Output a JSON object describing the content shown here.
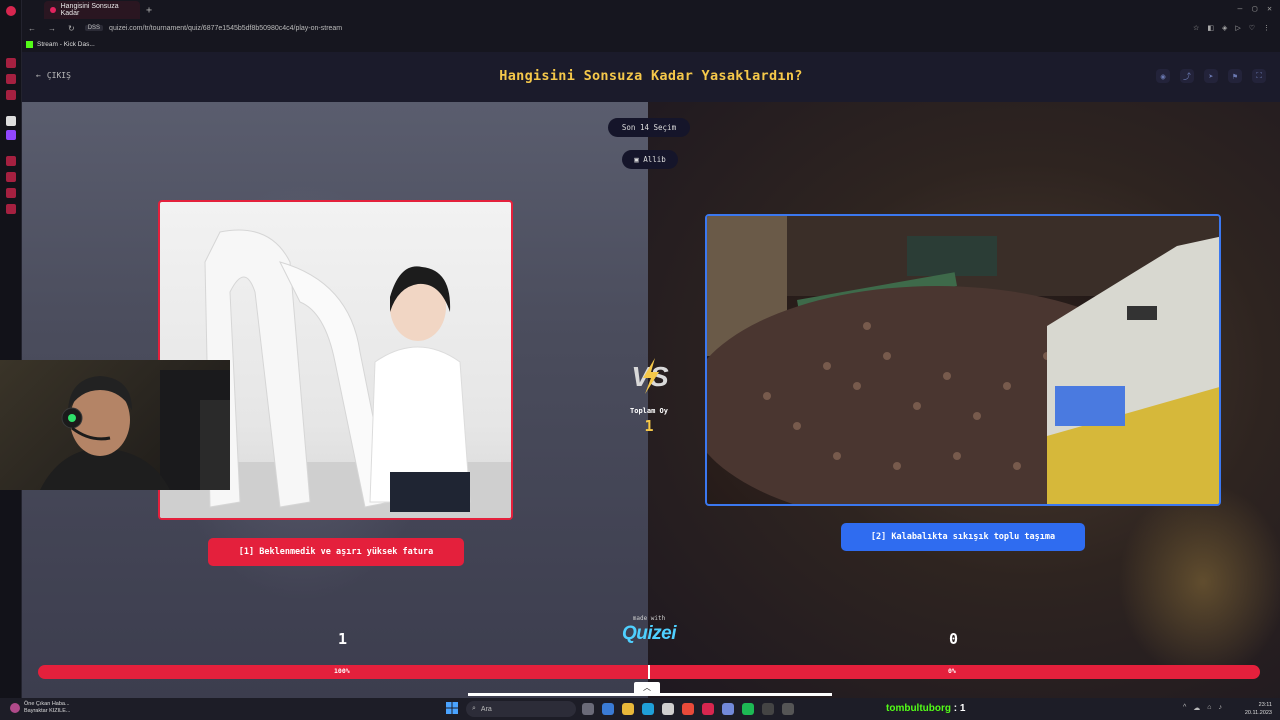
{
  "browser": {
    "tab_title": "Hangisini Sonsuza Kadar",
    "tab_plus": "+",
    "window_controls": [
      "—",
      "▢",
      "✕"
    ],
    "url_prefix": "DSS",
    "url": "quizei.com/tr/tournament/quiz/6877e1545b5df8b50980c4c4/play-on-stream",
    "bookmark": "Stream - Kick Das..."
  },
  "header": {
    "exit_label": "ÇIKIŞ",
    "title": "Hangisini Sonsuza Kadar Yasaklardın?",
    "tools": [
      "eye-icon",
      "share-icon",
      "send-icon",
      "flag-icon",
      "fullscreen-icon"
    ]
  },
  "status": {
    "round_label": "Son 14 Seçim",
    "user_label": "Allib"
  },
  "options": [
    {
      "label": "[1] Beklenmedik ve aşırı yüksek fatura",
      "count": "1",
      "percent": "100%",
      "color": "#e4203c"
    },
    {
      "label": "[2] Kalabalıkta sıkışık toplu taşıma",
      "count": "0",
      "percent": "0%",
      "color": "#2f6cf0"
    }
  ],
  "center": {
    "vs_text": "VS",
    "total_label": "Toplam Oy",
    "total_value": "1",
    "made_with": "made with",
    "brand": "Quizei"
  },
  "progress": {
    "left_fraction": 1.0
  },
  "taskbar": {
    "now_playing_line1": "Öne Çıkan Haba...",
    "now_playing_line2": "Bayraktar KIZILE...",
    "search_placeholder": "Ara",
    "ticker_name": "tombultuborg",
    "ticker_value": "1",
    "time": "23:11",
    "date": "20.11.2023"
  },
  "colors": {
    "accent_yellow": "#f5c84a",
    "red": "#e4203c",
    "blue": "#2f6cf0",
    "brand_cyan": "#4fd0ff"
  }
}
